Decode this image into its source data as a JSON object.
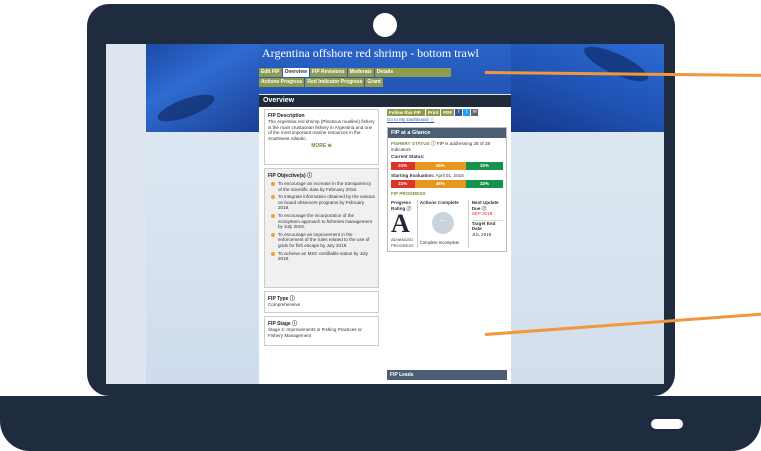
{
  "page": {
    "title": "Argentina offshore red shrimp - bottom trawl",
    "tabs_row1": [
      "Edit FIP",
      "Overview",
      "FIP Revisions",
      "Moderate",
      "Details"
    ],
    "tabs_row2": [
      "Actions Progress",
      "Red Indicator Progress",
      "Grant"
    ],
    "section": "Overview"
  },
  "description": {
    "label": "FIP Description",
    "text": "The Argentina red shrimp (Pleoticus muelleri) fishery is the main crustacean fishery in Argentina and one of the most important marine resources in the Southwest Atlantic.",
    "more": "MORE ⊕"
  },
  "objectives": {
    "label": "FIP Objective(s) ⓘ",
    "items": [
      "To encourage an increase in the transparency of the scientific data by February 2018.",
      "To integrate information obtained by the various on board observers programs by February 2018.",
      "To encourage the incorporation of the ecosystem approach to fisheries management by July 2019.",
      "To encourage an improvement in the enforcement of the rules related to the use of grids for fish escape by July 2019.",
      "To achieve an MSC certifiable status by July 2019."
    ]
  },
  "fip_type": {
    "label": "FIP Type ⓘ",
    "value": "Comprehensive"
  },
  "fip_stage": {
    "label": "FIP Stage ⓘ",
    "value": "Stage 4: Improvements in Fishing Practices or Fishery Management"
  },
  "tools": {
    "follow": "Follow this FIP",
    "print": "Print",
    "pdf": "PDF",
    "facebook": "f",
    "twitter": "t",
    "email": "✉",
    "dashboard": "Go to My Dashboard ⓘ"
  },
  "glance": {
    "header": "FIP at a Glance",
    "status_label": "FISHERY STATUS ⓘ",
    "status_text": "FIP is addressing 28 of 28 indicators",
    "current_label": "Current Status:",
    "current_bar": [
      "21%",
      "46%",
      "32%"
    ],
    "starting_label": "Starting Evaluation:",
    "starting_date": "April 01, 2016",
    "starting_bar": [
      "21%",
      "46%",
      "32%"
    ],
    "progress_label": "FIP PROGRESS",
    "rating_label": "Progress Rating ⓘ",
    "rating_value": "A",
    "rating_sub": "ADVANCED PROGRESS",
    "actions_label": "Actions Complete",
    "pie_center": "—",
    "legend_complete": "Complete",
    "legend_incomplete": "Incomplete",
    "next_label": "Next Update Due ⓘ",
    "next_value": "SEP 2018",
    "target_label": "Target End Date",
    "target_value": "JUL 2019"
  },
  "leads": {
    "header": "FIP Leads"
  },
  "colors": {
    "laptop": "#1f2c3f",
    "olive": "#8f9b4e",
    "red": "#d9352a",
    "amber": "#e8971e",
    "green": "#17924e",
    "callout": "#f0983a"
  }
}
